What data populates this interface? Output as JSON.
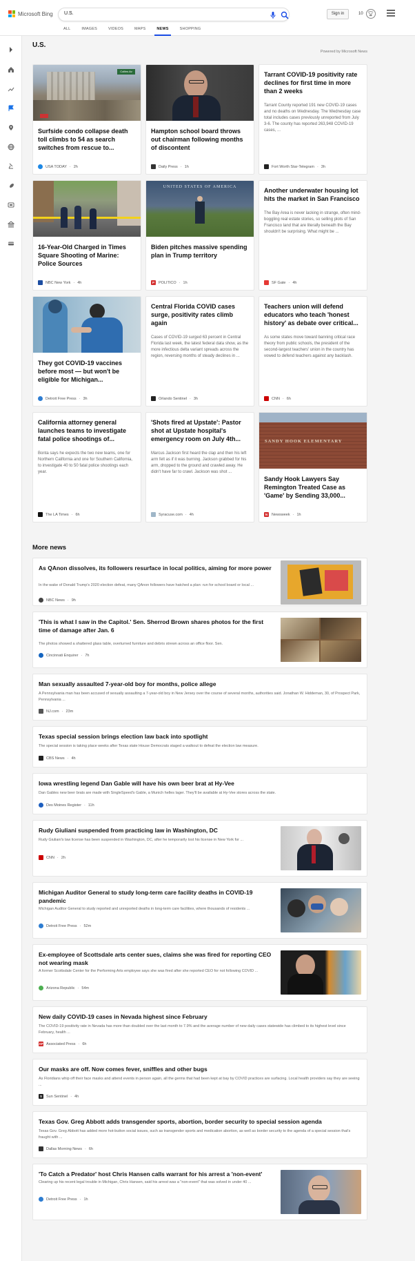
{
  "header": {
    "brand": "Microsoft Bing",
    "search_value": "U.S.",
    "signin_label": "Sign in",
    "rewards_count": "10",
    "tabs": [
      {
        "label": "ALL"
      },
      {
        "label": "IMAGES"
      },
      {
        "label": "VIDEOS"
      },
      {
        "label": "MAPS"
      },
      {
        "label": "NEWS"
      },
      {
        "label": "SHOPPING"
      }
    ],
    "active_tab": "NEWS"
  },
  "sidebar": {
    "icons": [
      "chevron-right-icon",
      "home-icon",
      "trending-icon",
      "flag-icon",
      "location-icon",
      "globe-icon",
      "science-icon",
      "rocket-icon",
      "entertainment-icon",
      "money-icon",
      "card-icon"
    ]
  },
  "main": {
    "section_title": "U.S.",
    "powered_by": "Powered by Microsoft News",
    "cards": [
      {
        "title": "Surfside condo collapse death toll climbs to 54 as search switches from rescue to...",
        "source": "USA TODAY",
        "time": "2h",
        "snippet": ""
      },
      {
        "title": "Hampton school board throws out chairman following months of discontent",
        "source": "Daily Press",
        "time": "1h",
        "snippet": ""
      },
      {
        "title": "Tarrant COVID-19 positivity rate declines for first time in more than 2 weeks",
        "source": "Fort Worth Star-Telegram",
        "time": "3h",
        "snippet": "Tarrant County reported 191 new COVID-19 cases and no deaths on Wednesday. The Wednesday case total includes cases previously unreported from July 3-6. The county has reported 263,948 COVID-19 cases, ..."
      },
      {
        "title": "16-Year-Old Charged in Times Square Shooting of Marine: Police Sources",
        "source": "NBC New York",
        "time": "4h",
        "snippet": ""
      },
      {
        "title": "Biden pitches massive spending plan in Trump territory",
        "source": "POLITICO",
        "time": "1h",
        "snippet": ""
      },
      {
        "title": "Another underwater housing lot hits the market in San Francisco",
        "source": "SF Gate",
        "time": "4h",
        "snippet": "The Bay Area is never lacking in strange, often mind-boggling real estate stories, so selling plots of San Francisco land that are literally beneath the Bay shouldn't be surprising. What might be ..."
      },
      {
        "title": "They got COVID-19 vaccines before most — but won't be eligible for Michigan...",
        "source": "Detroit Free Press",
        "time": "3h",
        "snippet": ""
      },
      {
        "title": "Central Florida COVID cases surge, positivity rates climb again",
        "source": "Orlando Sentinel",
        "time": "3h",
        "snippet": "Cases of COVID-19 surged 63 percent in Central Florida last week, the latest federal data show, as the more infectious delta variant spreads across the region, reversing months of steady declines in ..."
      },
      {
        "title": "Teachers union will defend educators who teach 'honest history' as debate over critical...",
        "source": "CNN",
        "time": "6h",
        "snippet": "As some states move toward banning critical race theory from public schools, the president of the second-largest teachers' union in the country has vowed to defend teachers against any backlash."
      },
      {
        "title": "California attorney general launches teams to investigate fatal police shootings of...",
        "source": "The LA Times",
        "time": "6h",
        "snippet": "Bonta says he expects the two new teams, one for Northern California and one for Southern California, to investigate 40 to 50 fatal police shootings each year."
      },
      {
        "title": "'Shots fired at Upstate': Pastor shot at Upstate hospital's emergency room on July 4th...",
        "source": "Syracuse.com",
        "time": "4h",
        "snippet": "Marcus Jackson first heard the clap and then his left arm felt as if it was burning. Jackson grabbed for his arm, dropped to the ground and crawled away. He didn't have far to crawl. Jackson was shot ..."
      },
      {
        "title": "Sandy Hook Lawyers Say Remington Treated Case as 'Game' by Sending 33,000...",
        "source": "Newsweek",
        "time": "1h",
        "snippet": "",
        "image_text": "SANDY HOOK ELEMENTARY"
      }
    ],
    "image_labels": {
      "biden_banner": "UNITED STATES OF AMERICA",
      "street_sign": "Collins Av"
    },
    "more_news_title": "More news",
    "more_news": [
      {
        "title": "As QAnon dissolves, its followers resurface in local politics, aiming for more power",
        "snippet": "In the wake of Donald Trump's 2020 election defeat, many QAnon followers have hatched a plan: run for school board or local ...",
        "source": "NBC News",
        "time": "9h"
      },
      {
        "title": "'This is what I saw in the Capitol.' Sen. Sherrod Brown shares photos for the first time of damage after Jan. 6",
        "snippet": "The photos showed a shattered glass table, overturned furniture and debris strewn across an office floor. Sen.",
        "source": "Cincinnati Enquirer",
        "time": "7h"
      },
      {
        "title": "Man sexually assaulted 7-year-old boy for months, police allege",
        "snippet": "A Pennsylvania man has been accused of sexually assaulting a 7-year-old boy in New Jersey over the course of several months, authorities said. Jonathan W. Hiddeman, 30, of Prospect Park, Pennsylvania ...",
        "source": "NJ.com",
        "time": "23m"
      },
      {
        "title": "Texas special session brings election law back into spotlight",
        "snippet": "The special session is taking place weeks after Texas state House Democrats staged a walkout to defeat the election law measure.",
        "source": "CBS News",
        "time": "4h"
      },
      {
        "title": "Iowa wrestling legend Dan Gable will have his own beer brat at Hy-Vee",
        "snippet": "Dan Gables new beer brats are made with SingleSpeed's Gable, a Munich helles lager. They'll be available at Hy-Vee stores across the state.",
        "source": "Des Moines Register",
        "time": "11h"
      },
      {
        "title": "Rudy Giuliani suspended from practicing law in Washington, DC",
        "snippet": "Rudy Giuliani's law license has been suspended in Washington, DC, after he temporarily lost his license in New York for ...",
        "source": "CNN",
        "time": "2h"
      },
      {
        "title": "Michigan Auditor General to study long-term care facility deaths in COVID-19 pandemic",
        "snippet": "Michigan Auditor General to study reported and unreported deaths in long-term care facilities, where thousands of residents ...",
        "source": "Detroit Free Press",
        "time": "52m"
      },
      {
        "title": "Ex-employee of Scottsdale arts center sues, claims she was fired for reporting CEO not wearing mask",
        "snippet": "A former Scottsdale Center for the Performing Arts employee says she was fired after she reported CEO for not following COVID ...",
        "source": "Arizona Republic",
        "time": "54m"
      },
      {
        "title": "New daily COVID-19 cases in Nevada highest since February",
        "snippet": "The COVID-19 positivity rate in Nevada has more than doubled over the last month to 7.9% and the average number of new daily cases statewide has climbed to its highest level since February, health ...",
        "source": "Associated Press",
        "time": "6h"
      },
      {
        "title": "Our masks are off. Now comes fever, sniffles and other bugs",
        "snippet": "As Floridians whip off their face masks and attend events in person again, all the germs that had been kept at bay by COVID practices are surfacing. Local health providers say they are seeing ...",
        "source": "Sun Sentinel",
        "time": "4h"
      },
      {
        "title": "Texas Gov. Greg Abbott adds transgender sports, abortion, border security to special session agenda",
        "snippet": "Texas Gov. Greg Abbott has added more hot-button social issues, such as transgender sports and medication abortion, as well as border security to the agenda of a special session that's fraught with ...",
        "source": "Dallas Morning News",
        "time": "6h"
      },
      {
        "title": "'To Catch a Predator' host Chris Hansen calls warrant for his arrest a 'non-event'",
        "snippet": "Clearing up his recent legal trouble in Michigan, Chris Hansen, said his arrest was a \"non-event\" that was solved in under 40 ...",
        "source": "Detroit Free Press",
        "time": "1h"
      }
    ]
  },
  "colors": {
    "accent": "#174ae4",
    "bing_blue": "#1a73e8"
  }
}
